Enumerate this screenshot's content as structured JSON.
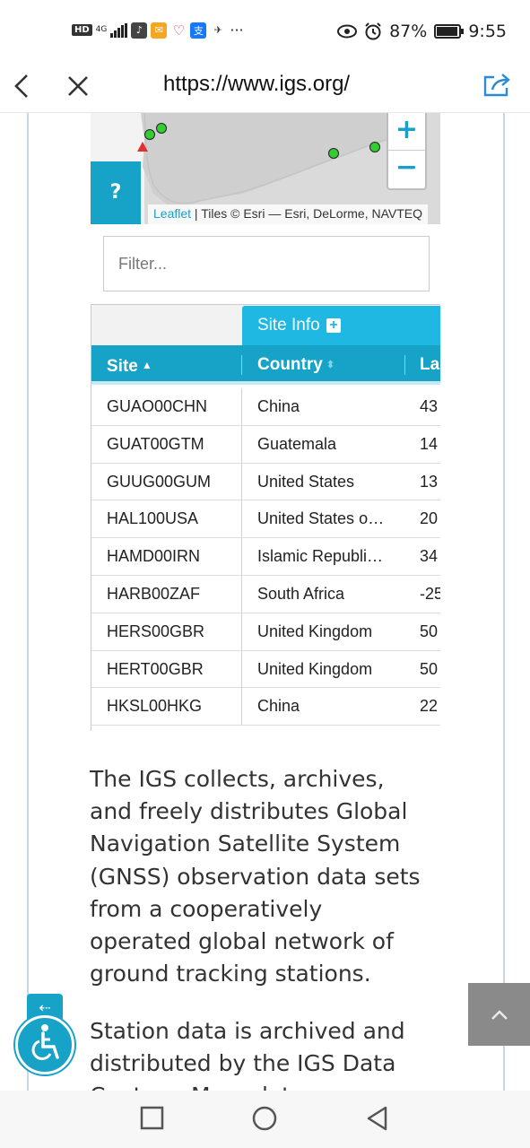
{
  "status_bar": {
    "hd_label": "HD",
    "network_label": "4G",
    "battery_percent": "87%",
    "battery_level": 0.87,
    "time": "9:55",
    "icons": [
      "hd-icon",
      "signal-icon",
      "app-icon",
      "mail-icon",
      "health-icon",
      "alipay-icon",
      "app2-icon",
      "more-icon",
      "eye-icon",
      "alarm-icon",
      "battery-icon"
    ]
  },
  "browser": {
    "url": "https://www.igs.org/",
    "icons": [
      "back-icon",
      "close-icon",
      "share-icon"
    ]
  },
  "map": {
    "help_label": "?",
    "zoom_in_label": "+",
    "zoom_out_label": "−",
    "attribution_link": "Leaflet",
    "attribution_text": " | Tiles © Esri — Esri, DeLorme, NAVTEQ",
    "marker_colors": {
      "station": "#33cc33",
      "alert": "#e03030"
    }
  },
  "filter": {
    "placeholder": "Filter...",
    "value": ""
  },
  "table": {
    "group_header": "Site Info",
    "columns": [
      "Site",
      "Country",
      "La"
    ],
    "rows": [
      {
        "site": "GUAO00CHN",
        "country": "China",
        "lat": "43"
      },
      {
        "site": "GUAT00GTM",
        "country": "Guatemala",
        "lat": "14"
      },
      {
        "site": "GUUG00GUM",
        "country": "United States",
        "lat": "13"
      },
      {
        "site": "HAL100USA",
        "country": "United States o…",
        "lat": "20"
      },
      {
        "site": "HAMD00IRN",
        "country": "Islamic Republi…",
        "lat": "34"
      },
      {
        "site": "HARB00ZAF",
        "country": "South Africa",
        "lat": "-25"
      },
      {
        "site": "HERS00GBR",
        "country": "United Kingdom",
        "lat": "50"
      },
      {
        "site": "HERT00GBR",
        "country": "United Kingdom",
        "lat": "50"
      },
      {
        "site": "HKSL00HKG",
        "country": "China",
        "lat": "22"
      }
    ]
  },
  "content": {
    "paragraph1": "The IGS collects, archives, and freely distributes Global Navigation Satellite System (GNSS) observation data sets from a cooperatively operated global network of ground tracking stations.",
    "paragraph2": "Station data is archived and distributed by the IGS Data Centers. More data availability"
  },
  "colors": {
    "accent": "#17a2c8",
    "accent_light": "#1fb8e2"
  }
}
